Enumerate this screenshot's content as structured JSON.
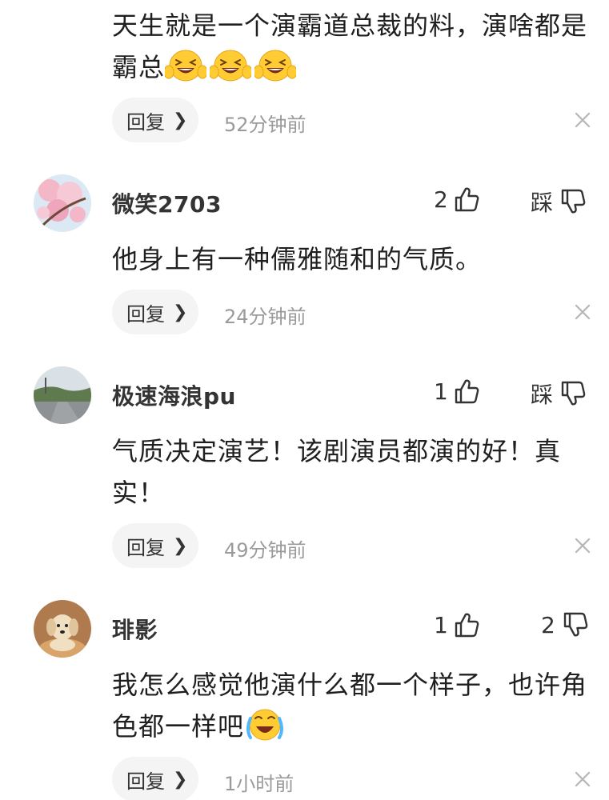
{
  "comments": [
    {
      "text": "天生就是一个演霸道总裁的料，演啥都是霸总",
      "emoji": "grinning-squint-emoji",
      "emoji_count": 3,
      "reply_label": "回复",
      "time": "52分钟前"
    },
    {
      "username": "微笑2703",
      "avatar": "cherry-blossom-avatar",
      "likes": "2",
      "dislike_label": "踩",
      "text": "他身上有一种儒雅随和的气质。",
      "reply_label": "回复",
      "time": "24分钟前"
    },
    {
      "username": "极速海浪pu",
      "avatar": "road-landscape-avatar",
      "likes": "1",
      "dislike_label": "踩",
      "text": "气质决定演艺！该剧演员都演的好！真实！",
      "reply_label": "回复",
      "time": "49分钟前"
    },
    {
      "username": "琲影",
      "avatar": "puppy-avatar",
      "likes": "1",
      "dislikes": "2",
      "text": "我怎么感觉他演什么都一个样子，也许角色都一样吧",
      "emoji": "crying-laughing-emoji",
      "reply_label": "回复",
      "time": "1小时前"
    }
  ],
  "icons": {
    "like": "thumbs-up-outline-icon",
    "dislike": "thumbs-down-outline-icon",
    "close": "close-icon",
    "reply_chevron": "chevron-right-icon"
  },
  "colors": {
    "reply_bg": "#f4f4f4",
    "time": "#9a9a9a",
    "emoji_face": "#ffcc33"
  }
}
